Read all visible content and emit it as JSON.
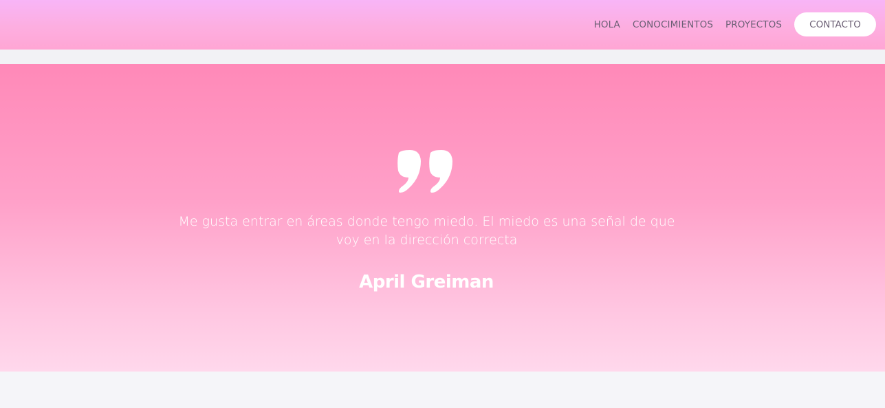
{
  "nav": {
    "items": [
      {
        "label": "HOLA"
      },
      {
        "label": "CONOCIMIENTOS"
      },
      {
        "label": "PROYECTOS"
      }
    ],
    "contact_label": "CONTACTO"
  },
  "quote": {
    "icon": "quote-icon",
    "text": "Me gusta entrar en áreas donde tengo miedo. El miedo es una señal de que voy en la dirección correcta",
    "author": "April Greiman"
  },
  "colors": {
    "nav_gradient_top": "#f8b5f7",
    "nav_gradient_bottom": "#ffa6d4",
    "hero_gradient_top": "#ff89b8",
    "hero_gradient_bottom": "#ffd8ec",
    "text_nav": "#6b5f74",
    "text_light": "#ffffff",
    "page_background": "#f5f5f9"
  }
}
